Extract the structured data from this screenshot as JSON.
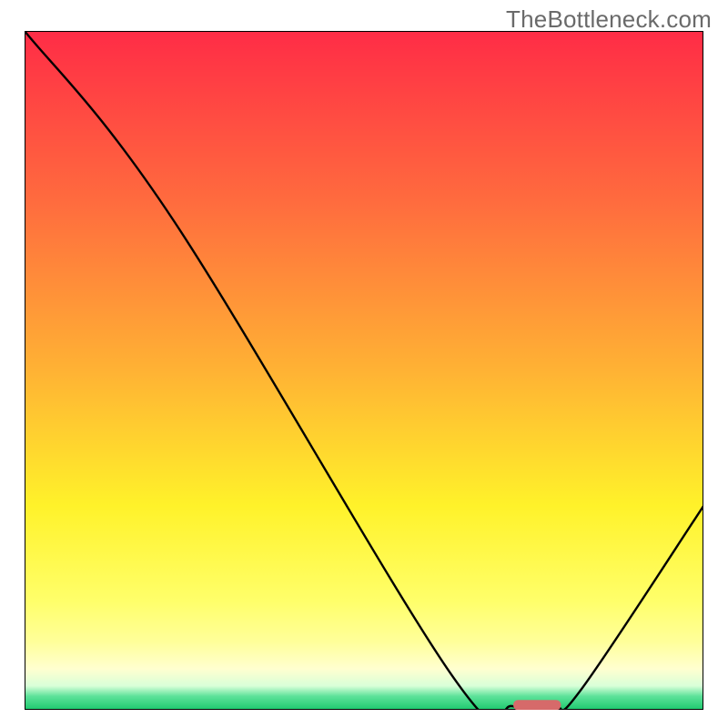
{
  "watermark": "TheBottleneck.com",
  "chart_data": {
    "type": "line",
    "title": "",
    "xlabel": "",
    "ylabel": "",
    "xlim": [
      0,
      100
    ],
    "ylim": [
      0,
      100
    ],
    "grid": false,
    "series": [
      {
        "name": "bottleneck-curve",
        "x": [
          0,
          22,
          63,
          72,
          78,
          82,
          100
        ],
        "y": [
          100,
          72,
          5,
          0.5,
          0.5,
          3,
          30
        ]
      }
    ],
    "marker": {
      "name": "optimal-marker",
      "x_start": 72,
      "x_end": 79,
      "y": 0.7,
      "color": "#d66a6a"
    },
    "background": {
      "type": "vertical-gradient",
      "stops": [
        {
          "pos": 0.0,
          "color": "#ff2c46"
        },
        {
          "pos": 0.25,
          "color": "#ff6b3e"
        },
        {
          "pos": 0.5,
          "color": "#ffb234"
        },
        {
          "pos": 0.7,
          "color": "#fff22a"
        },
        {
          "pos": 0.84,
          "color": "#ffff6a"
        },
        {
          "pos": 0.9,
          "color": "#ffff9a"
        },
        {
          "pos": 0.94,
          "color": "#ffffd0"
        },
        {
          "pos": 0.965,
          "color": "#d8ffd8"
        },
        {
          "pos": 0.98,
          "color": "#5de29a"
        },
        {
          "pos": 1.0,
          "color": "#1ec96e"
        }
      ]
    }
  }
}
